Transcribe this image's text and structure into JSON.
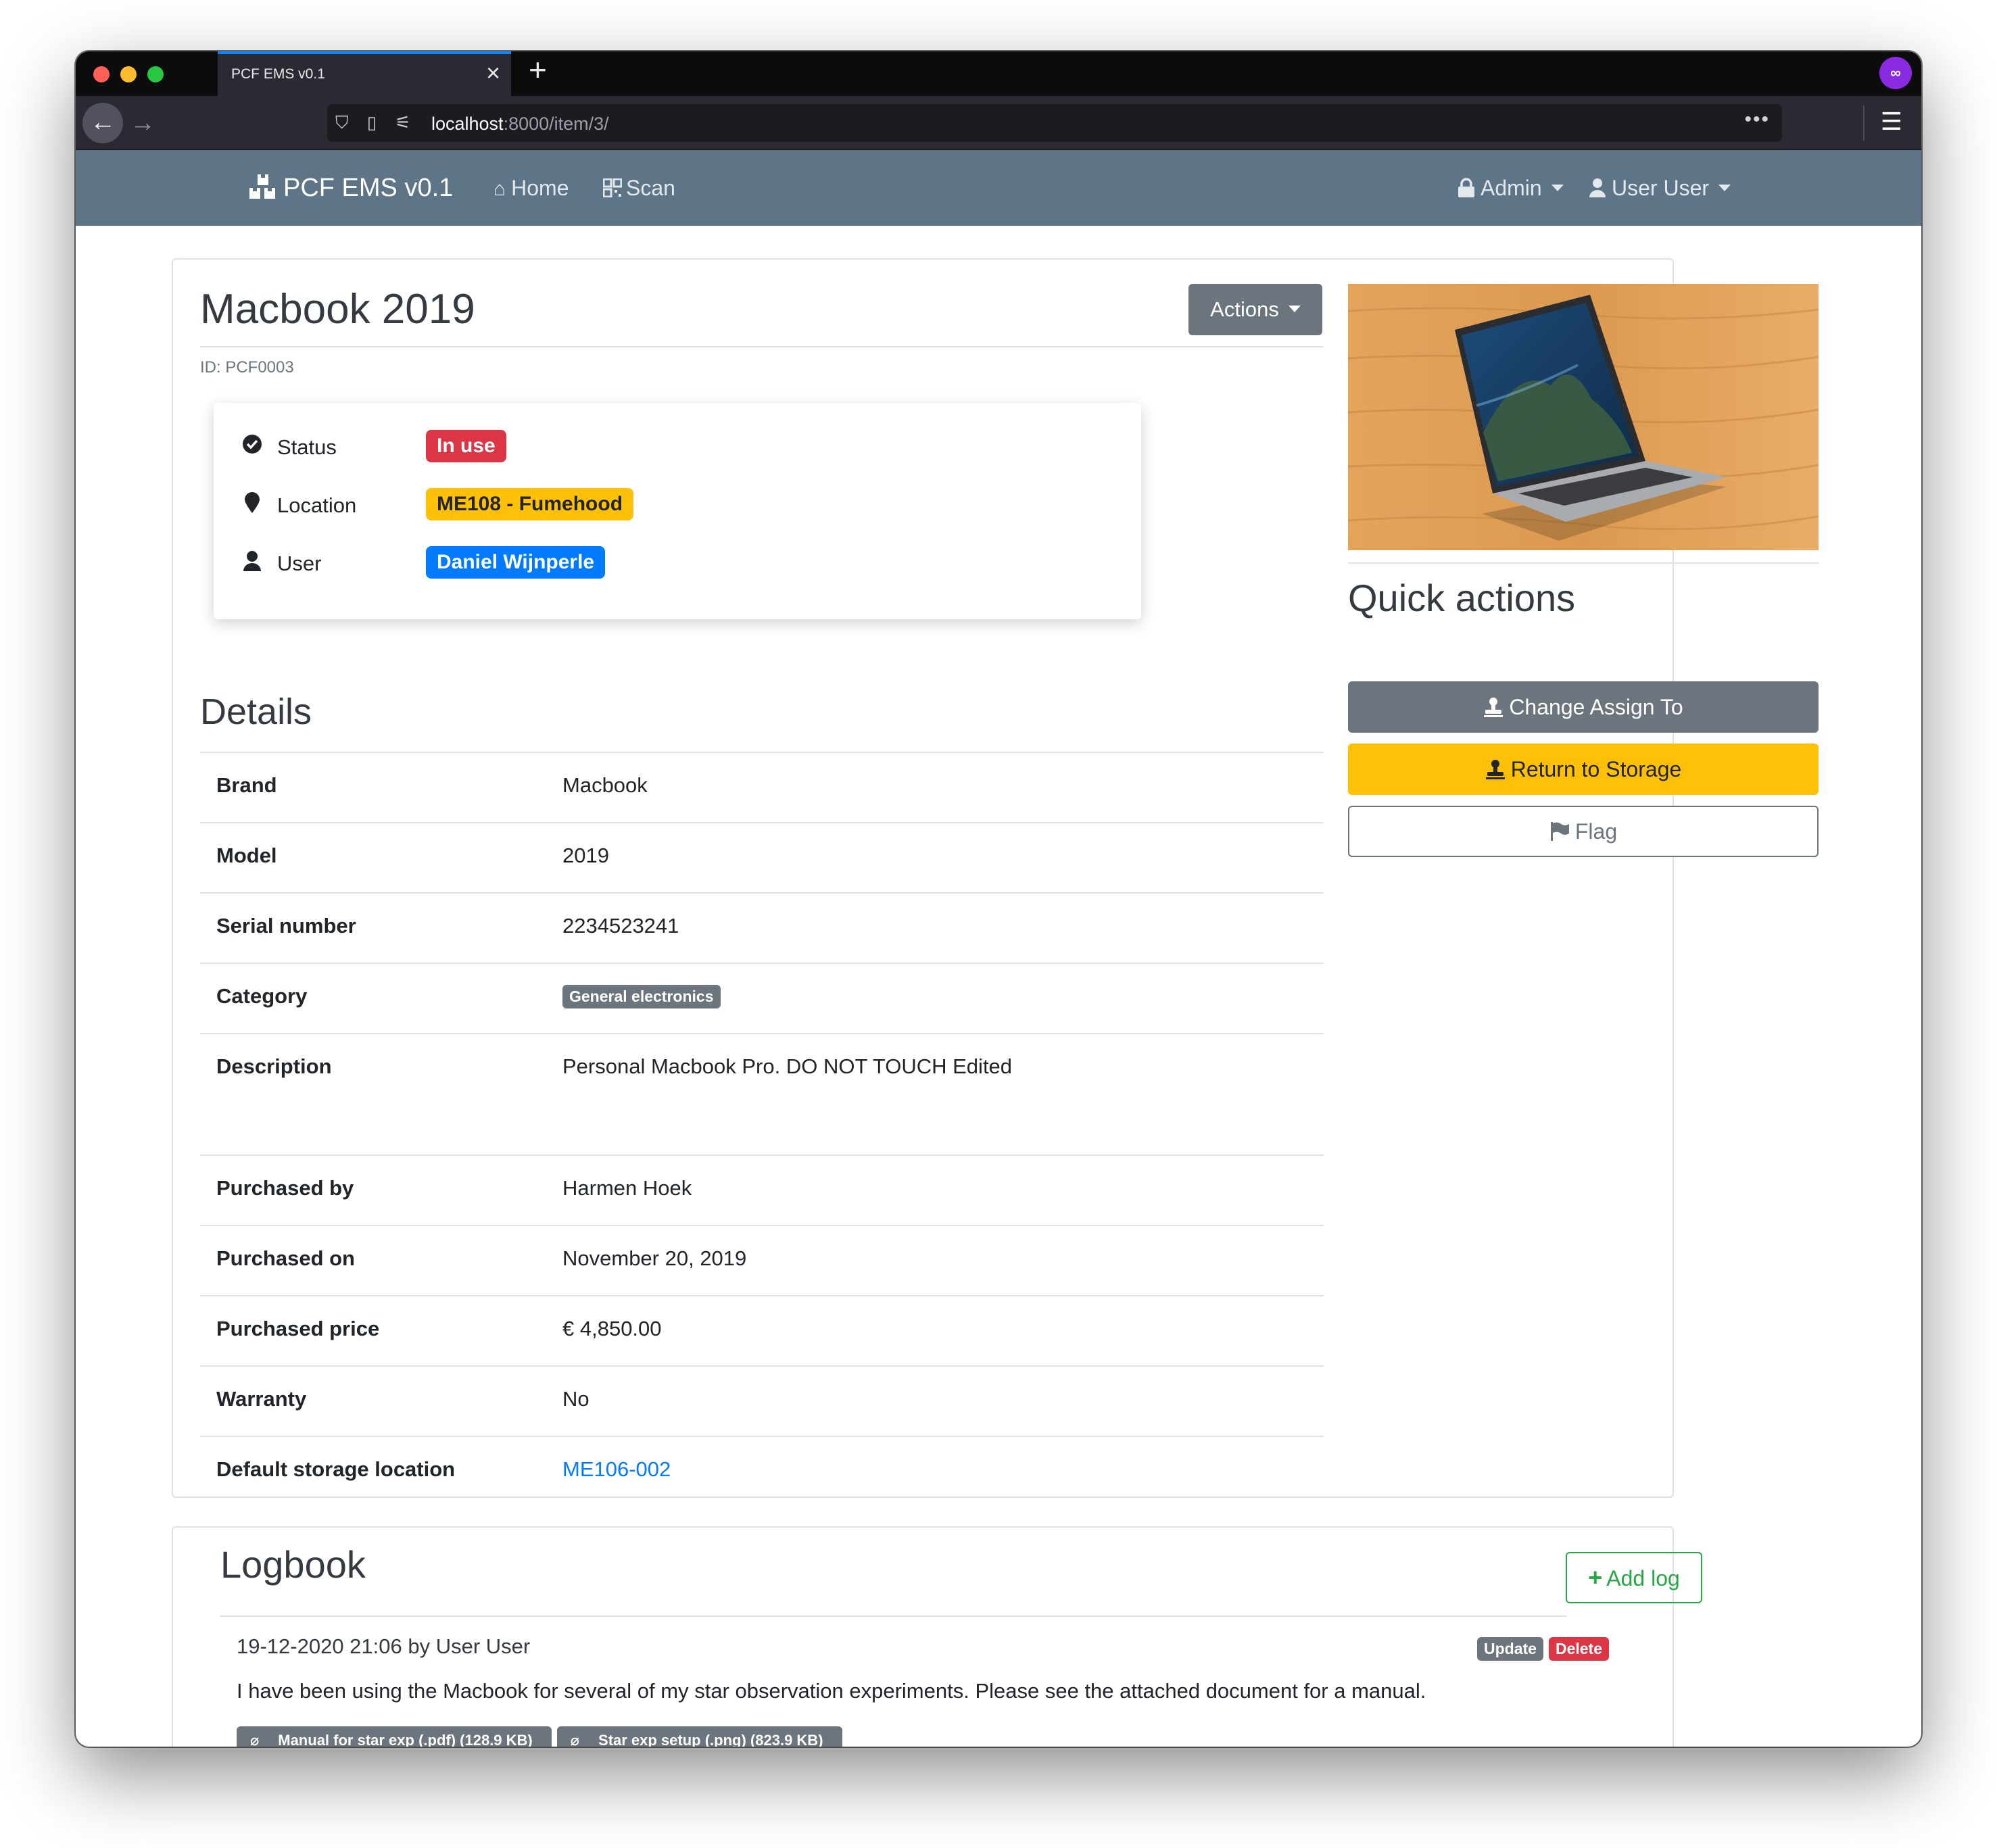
{
  "browser": {
    "tab_title": "PCF EMS v0.1",
    "url_host": "localhost",
    "url_path": ":8000/item/3/"
  },
  "nav": {
    "brand": "PCF EMS v0.1",
    "home": "Home",
    "scan": "Scan",
    "admin": "Admin",
    "user": "User User"
  },
  "item": {
    "title": "Macbook 2019",
    "actions_label": "Actions",
    "id_text": "ID: PCF0003",
    "status_label": "Status",
    "status_value": "In use",
    "location_label": "Location",
    "location_value": "ME108 - Fumehood",
    "user_label": "User",
    "user_value": "Daniel Wijnperle"
  },
  "details": {
    "heading": "Details",
    "rows": [
      {
        "label": "Brand",
        "value": "Macbook"
      },
      {
        "label": "Model",
        "value": "2019"
      },
      {
        "label": "Serial number",
        "value": "2234523241"
      },
      {
        "label": "Category",
        "value": "General electronics"
      },
      {
        "label": "Description",
        "value": "Personal Macbook Pro. DO NOT TOUCH Edited"
      },
      {
        "label": "Purchased by",
        "value": "Harmen Hoek"
      },
      {
        "label": "Purchased on",
        "value": "November 20, 2019"
      },
      {
        "label": "Purchased price",
        "value": "€ 4,850.00"
      },
      {
        "label": "Warranty",
        "value": "No"
      },
      {
        "label": "Default storage location",
        "value": "ME106-002"
      }
    ]
  },
  "quick_actions": {
    "heading": "Quick actions",
    "change_assign": "Change Assign To",
    "return_storage": "Return to Storage",
    "flag": "Flag"
  },
  "logbook": {
    "heading": "Logbook",
    "add_log": "Add log",
    "entries": [
      {
        "meta": "19-12-2020 21:06 by User User",
        "update": "Update",
        "delete": "Delete",
        "text": "I have been using the Macbook for several of my star observation experiments. Please see the attached document for a manual.",
        "attachments": [
          "Manual for star exp (.pdf) (128.9 KB)",
          "Star exp setup (.png) (823.9 KB)"
        ]
      }
    ]
  },
  "colors": {
    "navbar": "#5e7587",
    "danger": "#dc3545",
    "warning": "#ffc107",
    "primary": "#007bff",
    "secondary": "#6c757d",
    "success": "#28a745"
  }
}
